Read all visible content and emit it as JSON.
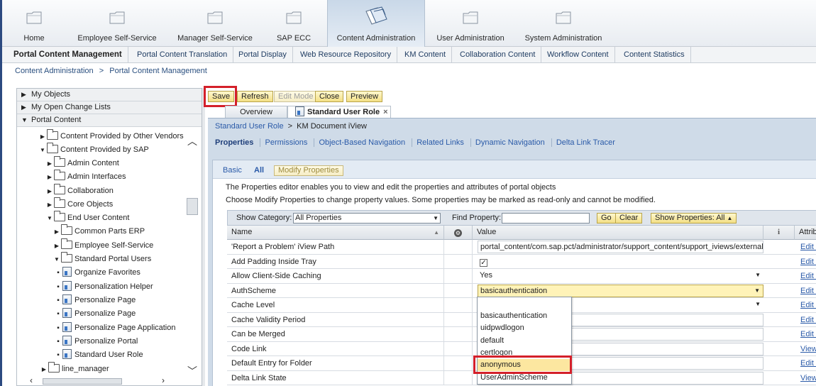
{
  "top_nav": {
    "items": [
      {
        "label": "Home",
        "icon": "folder-icon"
      },
      {
        "label": "Employee Self-Service",
        "icon": "folder-icon"
      },
      {
        "label": "Manager Self-Service",
        "icon": "folder-icon"
      },
      {
        "label": "SAP ECC",
        "icon": "folder-icon"
      },
      {
        "label": "Content Administration",
        "icon": "documents-icon",
        "active": true
      },
      {
        "label": "User Administration",
        "icon": "folder-icon"
      },
      {
        "label": "System Administration",
        "icon": "folder-icon"
      }
    ]
  },
  "sub_nav": {
    "items": [
      "Portal Content Management",
      "Portal Content Translation",
      "Portal Display",
      "Web Resource Repository",
      "KM Content",
      "Collaboration Content",
      "Workflow Content",
      "Content Statistics"
    ],
    "active": "Portal Content Management"
  },
  "breadcrumb": {
    "items": [
      "Content Administration",
      "Portal Content Management"
    ],
    "separator": ">"
  },
  "left_panel": {
    "accordions": [
      "My Objects",
      "My Open Change Lists",
      "Portal Content"
    ],
    "tree": [
      "Content Provided by Other Vendors",
      "Content Provided by SAP",
      "Admin Content",
      "Admin Interfaces",
      "Collaboration",
      "Core Objects",
      "End User Content",
      "Common Parts ERP",
      "Employee Self-Service",
      "Standard Portal Users",
      "Organize Favorites",
      "Personalization Helper",
      "Personalize Page",
      "Personalize Page",
      "Personalize Page Application",
      "Personalize Portal",
      "Standard User Role",
      "line_manager"
    ]
  },
  "toolbar": {
    "save": "Save",
    "refresh": "Refresh",
    "edit_mode": "Edit Mode",
    "close": "Close",
    "preview": "Preview"
  },
  "editor_tabs": {
    "overview": "Overview",
    "current": "Standard User Role",
    "close_glyph": "×"
  },
  "object_path": {
    "parent": "Standard User Role",
    "separator": ">",
    "current": "KM Document iView"
  },
  "property_tabs": [
    "Properties",
    "Permissions",
    "Object-Based Navigation",
    "Related Links",
    "Dynamic Navigation",
    "Delta Link Tracer"
  ],
  "editor": {
    "basic": "Basic",
    "all": "All",
    "modify_properties": "Modify Properties",
    "info_line_1": "The Properties editor enables you to view and edit the properties and attributes of portal objects",
    "info_line_2": "Choose Modify Properties to change property values. Some properties may be marked as read-only and cannot be modified.",
    "show_category_label": "Show Category:",
    "show_category_value": "All Properties",
    "find_property_label": "Find Property:",
    "find_property_value": "",
    "go": "Go",
    "clear": "Clear",
    "show_properties": "Show Properties: All"
  },
  "grid": {
    "columns": {
      "name": "Name",
      "value": "Value",
      "attributes": "Attrib"
    },
    "rows": [
      {
        "name": "'Report a Problem' iView Path",
        "value": "portal_content/com.sap.pct/administrator/support_content/support_iviews/external_su",
        "type": "text",
        "action": "Edit at"
      },
      {
        "name": "Add Padding Inside Tray",
        "value": "✓",
        "type": "checkbox",
        "action": "Edit at"
      },
      {
        "name": "Allow Client-Side Caching",
        "value": "Yes",
        "type": "select",
        "action": "Edit at"
      },
      {
        "name": "AuthScheme",
        "value": "basicauthentication",
        "type": "select-active",
        "action": "Edit at"
      },
      {
        "name": "Cache Level",
        "value": "",
        "type": "select",
        "action": "Edit at"
      },
      {
        "name": "Cache Validity Period",
        "value": "",
        "type": "text",
        "action": "Edit at"
      },
      {
        "name": "Can be Merged",
        "value": "",
        "type": "text",
        "action": "Edit at"
      },
      {
        "name": "Code Link",
        "value": "",
        "type": "text",
        "action": "View"
      },
      {
        "name": "Default Entry for Folder",
        "value": "",
        "type": "text",
        "action": "Edit at"
      },
      {
        "name": "Delta Link State",
        "value": "",
        "type": "text",
        "action": "View"
      }
    ]
  },
  "authscheme_dropdown": {
    "options": [
      "basicauthentication",
      "uidpwdlogon",
      "default",
      "certlogon",
      "anonymous",
      "UserAdminScheme"
    ],
    "highlighted": "anonymous"
  },
  "colors": {
    "highlight_box": "#d4202a",
    "button_yellow": "#f3df85",
    "link_blue": "#2a5aa8"
  }
}
